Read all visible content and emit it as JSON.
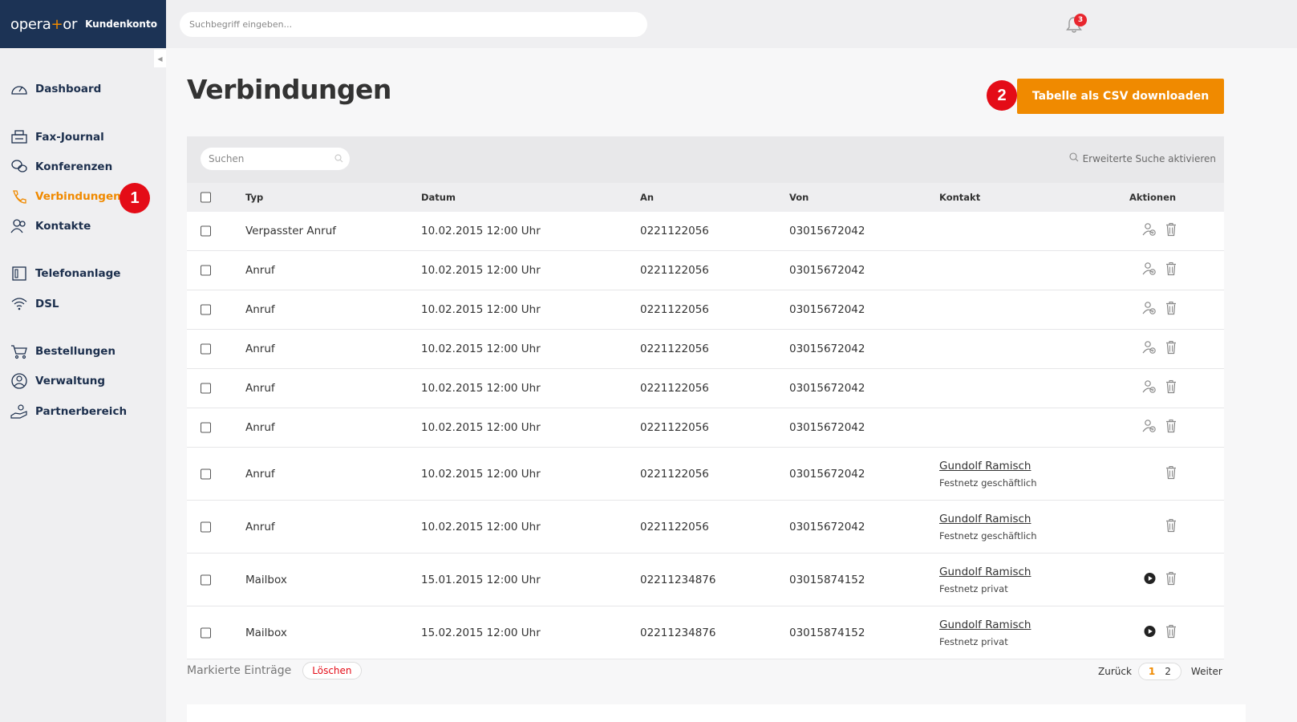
{
  "brand": {
    "logo_pre": "opera",
    "logo_plus": "+",
    "logo_post": "or",
    "account": "Kundenkonto"
  },
  "top_search": {
    "placeholder": "Suchbegriff eingeben..."
  },
  "notifications": {
    "count": "3"
  },
  "sidebar": {
    "items": [
      {
        "label": "Dashboard",
        "icon": "speedometer-icon"
      },
      {
        "label": "Fax-Journal",
        "icon": "fax-icon"
      },
      {
        "label": "Konferenzen",
        "icon": "chat-bubbles-icon"
      },
      {
        "label": "Verbindungen",
        "icon": "phone-icon",
        "active": true
      },
      {
        "label": "Kontakte",
        "icon": "contacts-icon"
      },
      {
        "label": "Telefonanlage",
        "icon": "phone-system-icon"
      },
      {
        "label": "DSL",
        "icon": "wifi-icon"
      },
      {
        "label": "Bestellungen",
        "icon": "cart-icon"
      },
      {
        "label": "Verwaltung",
        "icon": "user-circle-icon"
      },
      {
        "label": "Partnerbereich",
        "icon": "partner-hand-icon"
      }
    ]
  },
  "markers": {
    "one": "1",
    "two": "2"
  },
  "page": {
    "title": "Verbindungen",
    "csv_button": "Tabelle als CSV downloaden"
  },
  "table": {
    "search_placeholder": "Suchen",
    "advanced_search": "Erweiterte Suche aktivieren",
    "headers": {
      "typ": "Typ",
      "datum": "Datum",
      "an": "An",
      "von": "Von",
      "kontakt": "Kontakt",
      "aktionen": "Aktionen"
    },
    "rows": [
      {
        "typ": "Verpasster Anruf",
        "datum": "10.02.2015 12:00 Uhr",
        "an": "0221122056",
        "von": "03015672042",
        "kontakt": "",
        "kontakt_sub": ""
      },
      {
        "typ": "Anruf",
        "datum": "10.02.2015 12:00 Uhr",
        "an": "0221122056",
        "von": "03015672042",
        "kontakt": "",
        "kontakt_sub": ""
      },
      {
        "typ": "Anruf",
        "datum": "10.02.2015 12:00 Uhr",
        "an": "0221122056",
        "von": "03015672042",
        "kontakt": "",
        "kontakt_sub": ""
      },
      {
        "typ": "Anruf",
        "datum": "10.02.2015 12:00 Uhr",
        "an": "0221122056",
        "von": "03015672042",
        "kontakt": "",
        "kontakt_sub": ""
      },
      {
        "typ": "Anruf",
        "datum": "10.02.2015 12:00 Uhr",
        "an": "0221122056",
        "von": "03015672042",
        "kontakt": "",
        "kontakt_sub": ""
      },
      {
        "typ": "Anruf",
        "datum": "10.02.2015 12:00 Uhr",
        "an": "0221122056",
        "von": "03015672042",
        "kontakt": "",
        "kontakt_sub": ""
      },
      {
        "typ": "Anruf",
        "datum": "10.02.2015 12:00 Uhr",
        "an": "0221122056",
        "von": "03015672042",
        "kontakt": "Gundolf Ramisch",
        "kontakt_sub": "Festnetz geschäftlich"
      },
      {
        "typ": "Anruf",
        "datum": "10.02.2015 12:00 Uhr",
        "an": "0221122056",
        "von": "03015672042",
        "kontakt": "Gundolf Ramisch",
        "kontakt_sub": "Festnetz geschäftlich"
      },
      {
        "typ": "Mailbox",
        "datum": "15.01.2015 12:00 Uhr",
        "an": "02211234876",
        "von": "03015874152",
        "kontakt": "Gundolf Ramisch",
        "kontakt_sub": "Festnetz privat"
      },
      {
        "typ": "Mailbox",
        "datum": "15.02.2015 12:00 Uhr",
        "an": "02211234876",
        "von": "03015874152",
        "kontakt": "Gundolf Ramisch",
        "kontakt_sub": "Festnetz privat"
      }
    ]
  },
  "footer": {
    "marked": "Markierte Einträge",
    "delete": "Löschen",
    "back": "Zurück",
    "page1": "1",
    "page2": "2",
    "next": "Weiter"
  },
  "colors": {
    "accent": "#f08a00",
    "brand": "#1c3355",
    "marker": "#e40c17"
  }
}
